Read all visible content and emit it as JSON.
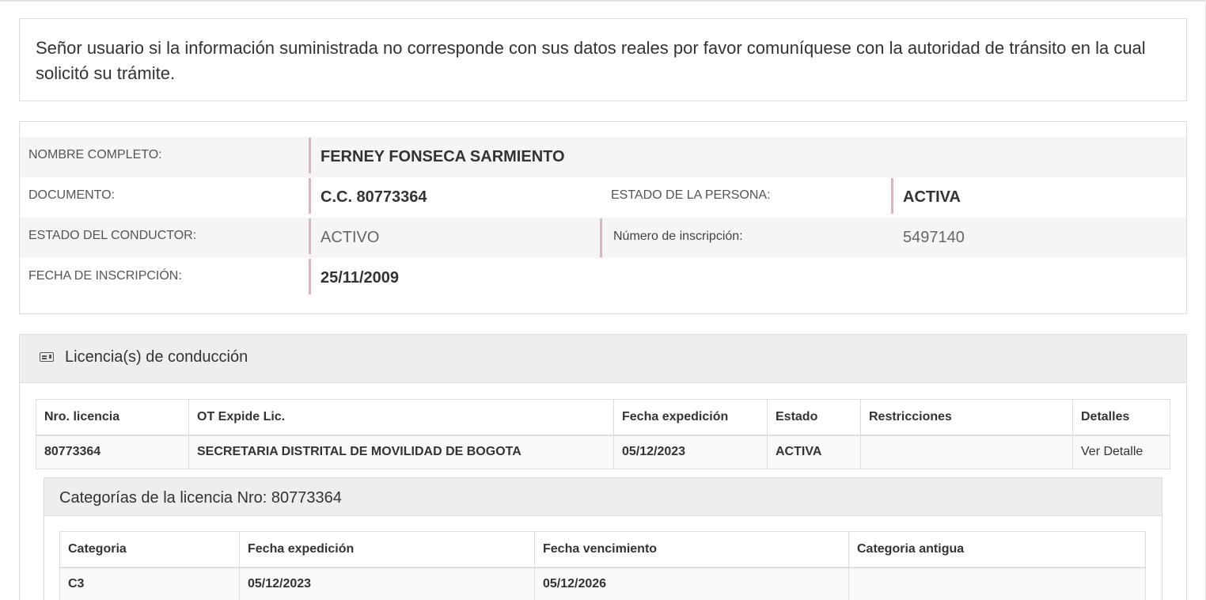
{
  "notice": {
    "text": "Señor usuario si la información suministrada no corresponde con sus datos reales por favor comuníquese con la autoridad de tránsito en la cual solicitó su trámite."
  },
  "person": {
    "nombre_label": "NOMBRE COMPLETO:",
    "nombre_value": "FERNEY FONSECA SARMIENTO",
    "documento_label": "DOCUMENTO:",
    "documento_value": "C.C. 80773364",
    "estado_persona_label": "ESTADO DE LA PERSONA:",
    "estado_persona_value": "ACTIVA",
    "estado_conductor_label": "ESTADO DEL CONDUCTOR:",
    "estado_conductor_value": "ACTIVO",
    "numero_inscripcion_label": "Número de inscripción:",
    "numero_inscripcion_value": "5497140",
    "fecha_inscripcion_label": "FECHA DE INSCRIPCIÓN:",
    "fecha_inscripcion_value": "25/11/2009"
  },
  "licenses": {
    "title": "Licencia(s) de conducción",
    "icon": "id-card-icon",
    "headers": [
      "Nro. licencia",
      "OT Expide Lic.",
      "Fecha expedición",
      "Estado",
      "Restricciones",
      "Detalles"
    ],
    "rows": [
      {
        "nro": "80773364",
        "ot": "SECRETARIA DISTRITAL DE MOVILIDAD DE BOGOTA",
        "fecha": "05/12/2023",
        "estado": "ACTIVA",
        "restricciones": "",
        "detalles": "Ver Detalle"
      }
    ]
  },
  "categories": {
    "title": "Categorías de la licencia Nro: 80773364",
    "headers": [
      "Categoria",
      "Fecha expedición",
      "Fecha vencimiento",
      "Categoria antigua"
    ],
    "rows": [
      {
        "categoria": "C3",
        "fecha_exp": "05/12/2023",
        "fecha_venc": "05/12/2026",
        "antigua": ""
      }
    ]
  }
}
